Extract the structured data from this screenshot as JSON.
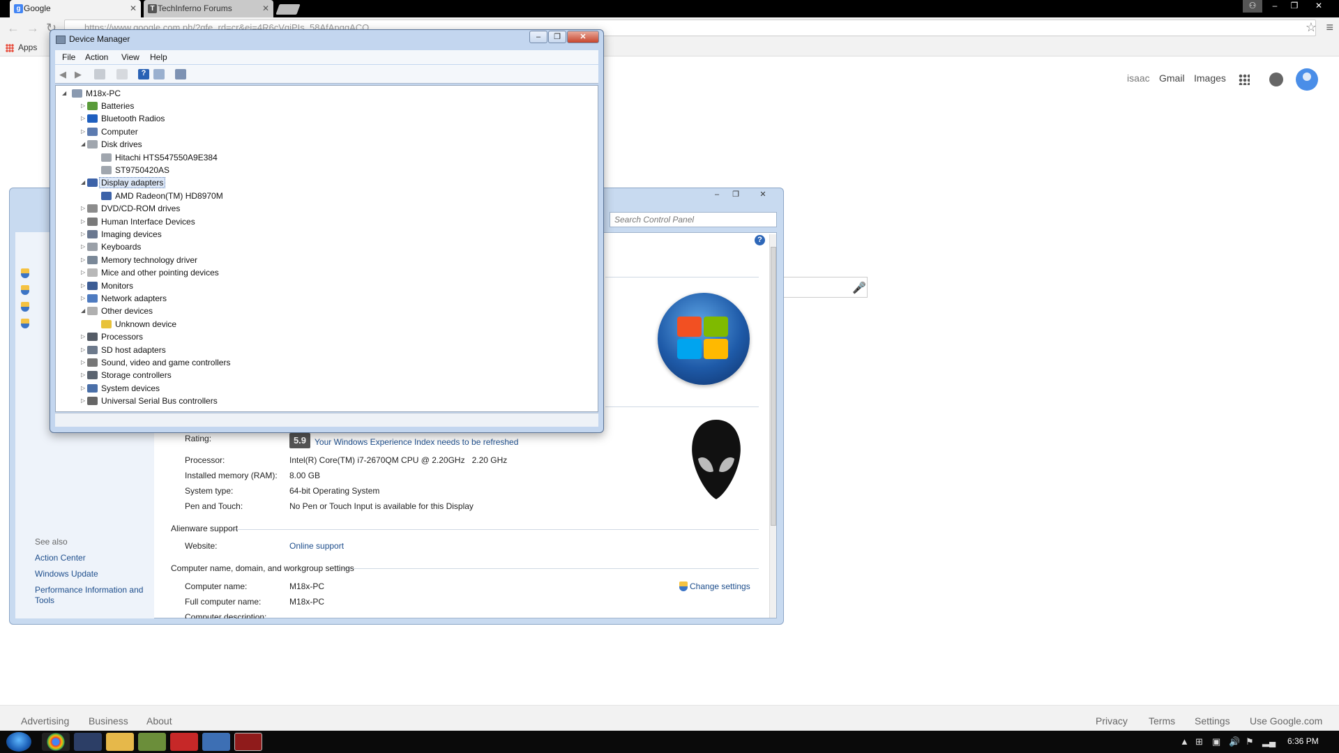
{
  "browser": {
    "tabs": [
      {
        "title": "Google",
        "favicon": "google-g"
      },
      {
        "title": "TechInferno Forums",
        "favicon": "ti"
      }
    ],
    "address": "https://www.google.com.ph/?gfe_rd=cr&ei=4R6cVqiPIs_58AfApqqACQ",
    "bookmarks": {
      "apps_label": "Apps"
    }
  },
  "google": {
    "nav": {
      "user": "isaac",
      "gmail": "Gmail",
      "images": "Images"
    },
    "footer": {
      "left": [
        "Advertising",
        "Business",
        "About"
      ],
      "right": [
        "Privacy",
        "Terms",
        "Settings",
        "Use Google.com"
      ]
    }
  },
  "system_window": {
    "search_placeholder": "Search Control Panel",
    "see_also": "See also",
    "see_also_links": [
      "Action Center",
      "Windows Update",
      "Performance Information and Tools"
    ],
    "rating_label": "Rating:",
    "rating_value": "5.9",
    "rating_link": "Your Windows Experience Index needs to be refreshed",
    "specs": [
      {
        "label": "Processor:",
        "value": "Intel(R) Core(TM) i7-2670QM CPU @ 2.20GHz   2.20 GHz"
      },
      {
        "label": "Installed memory (RAM):",
        "value": "8.00 GB"
      },
      {
        "label": "System type:",
        "value": "64-bit Operating System"
      },
      {
        "label": "Pen and Touch:",
        "value": "No Pen or Touch Input is available for this Display"
      }
    ],
    "support_section": "Alienware support",
    "website_label": "Website:",
    "website_link": "Online support",
    "name_section": "Computer name, domain, and workgroup settings",
    "change_settings": "Change settings",
    "computer_name_label": "Computer name:",
    "computer_name": "M18x-PC",
    "full_name_label": "Full computer name:",
    "full_name": "M18x-PC",
    "description_label": "Computer description:"
  },
  "device_manager": {
    "title": "Device Manager",
    "menu": [
      "File",
      "Action",
      "View",
      "Help"
    ],
    "root": "M18x-PC",
    "nodes": [
      {
        "label": "Batteries",
        "level": 1,
        "state": "collapsed",
        "icon": "battery-icon"
      },
      {
        "label": "Bluetooth Radios",
        "level": 1,
        "state": "collapsed",
        "icon": "bluetooth-icon"
      },
      {
        "label": "Computer",
        "level": 1,
        "state": "collapsed",
        "icon": "computer-icon"
      },
      {
        "label": "Disk drives",
        "level": 1,
        "state": "expanded",
        "icon": "disk-icon"
      },
      {
        "label": "Hitachi HTS547550A9E384",
        "level": 2,
        "state": "leaf",
        "icon": "disk-icon"
      },
      {
        "label": "ST9750420AS",
        "level": 2,
        "state": "leaf",
        "icon": "disk-icon"
      },
      {
        "label": "Display adapters",
        "level": 1,
        "state": "expanded",
        "icon": "display-icon",
        "selected": true
      },
      {
        "label": "AMD Radeon(TM) HD8970M",
        "level": 2,
        "state": "leaf",
        "icon": "display-icon"
      },
      {
        "label": "DVD/CD-ROM drives",
        "level": 1,
        "state": "collapsed",
        "icon": "dvd-icon"
      },
      {
        "label": "Human Interface Devices",
        "level": 1,
        "state": "collapsed",
        "icon": "hid-icon"
      },
      {
        "label": "Imaging devices",
        "level": 1,
        "state": "collapsed",
        "icon": "camera-icon"
      },
      {
        "label": "Keyboards",
        "level": 1,
        "state": "collapsed",
        "icon": "keyboard-icon"
      },
      {
        "label": "Memory technology driver",
        "level": 1,
        "state": "collapsed",
        "icon": "memory-icon"
      },
      {
        "label": "Mice and other pointing devices",
        "level": 1,
        "state": "collapsed",
        "icon": "mouse-icon"
      },
      {
        "label": "Monitors",
        "level": 1,
        "state": "collapsed",
        "icon": "monitor-icon"
      },
      {
        "label": "Network adapters",
        "level": 1,
        "state": "collapsed",
        "icon": "network-icon"
      },
      {
        "label": "Other devices",
        "level": 1,
        "state": "expanded",
        "icon": "unknown-icon"
      },
      {
        "label": "Unknown device",
        "level": 2,
        "state": "leaf",
        "icon": "warning-icon"
      },
      {
        "label": "Processors",
        "level": 1,
        "state": "collapsed",
        "icon": "cpu-icon"
      },
      {
        "label": "SD host adapters",
        "level": 1,
        "state": "collapsed",
        "icon": "sd-icon"
      },
      {
        "label": "Sound, video and game controllers",
        "level": 1,
        "state": "collapsed",
        "icon": "speaker-icon"
      },
      {
        "label": "Storage controllers",
        "level": 1,
        "state": "collapsed",
        "icon": "storage-icon"
      },
      {
        "label": "System devices",
        "level": 1,
        "state": "collapsed",
        "icon": "system-icon"
      },
      {
        "label": "Universal Serial Bus controllers",
        "level": 1,
        "state": "collapsed",
        "icon": "usb-icon"
      }
    ]
  },
  "taskbar": {
    "time": "6:36 PM",
    "apps": [
      "chrome-icon",
      "monitor-app-icon",
      "explorer-icon",
      "app-icon",
      "filezilla-icon",
      "remote-desktop-icon",
      "device-manager-icon"
    ]
  }
}
